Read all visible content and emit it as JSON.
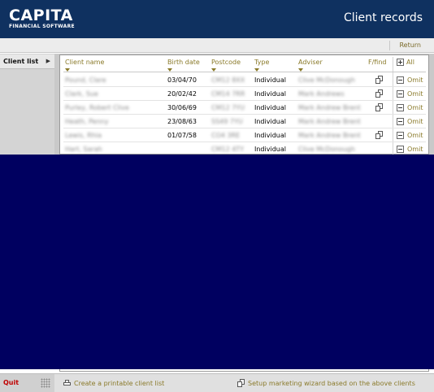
{
  "header": {
    "logo_main": "CAPITA",
    "logo_sub": "FINANCIAL SOFTWARE",
    "title": "Client records"
  },
  "toolbar": {
    "return_label": "Return"
  },
  "sidebar": {
    "items": [
      {
        "label": "Client list",
        "icon": "triangle-right-icon"
      }
    ]
  },
  "table": {
    "columns": [
      "Client name",
      "Birth date",
      "Postcode",
      "Type",
      "Adviser",
      "F/find"
    ],
    "all_label": "All",
    "omit_label": "Omit",
    "rows": [
      {
        "name": "Pound, Clare",
        "birth": "03/04/70",
        "postcode": "CM12 8XX",
        "type": "Individual",
        "adviser": "Clive McDonough",
        "ffind": true
      },
      {
        "name": "Clark, Sue",
        "birth": "20/02/42",
        "postcode": "CM14 7RR",
        "type": "Individual",
        "adviser": "Mark Andrews",
        "ffind": true
      },
      {
        "name": "Purley, Robert Clive",
        "birth": "30/06/69",
        "postcode": "CM12 7YU",
        "type": "Individual",
        "adviser": "Mark Andrew Brent",
        "ffind": true
      },
      {
        "name": "Heath, Penny",
        "birth": "23/08/63",
        "postcode": "SS49 7YU",
        "type": "Individual",
        "adviser": "Mark Andrew Brent",
        "ffind": false
      },
      {
        "name": "Lewis, Rhia",
        "birth": "01/07/58",
        "postcode": "CO4 3RE",
        "type": "Individual",
        "adviser": "Mark Andrew Brent",
        "ffind": true
      },
      {
        "name": "Hart, Sarah",
        "birth": "",
        "postcode": "CM12 4TY",
        "type": "Individual",
        "adviser": "Clive McDonough",
        "ffind": false
      }
    ]
  },
  "footer": {
    "quit_label": "Quit",
    "print_label": "Create a printable client list",
    "wizard_label": "Setup marketing wizard based on the above clients"
  },
  "colors": {
    "header_bg": "#0f3160",
    "overlay": "#000060",
    "link": "#8a7a2a",
    "quit": "#c00000"
  }
}
